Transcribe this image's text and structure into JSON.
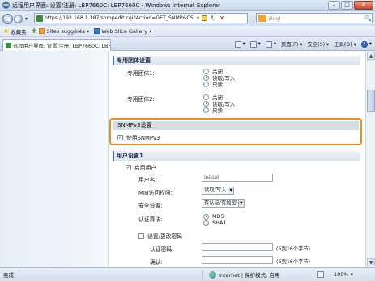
{
  "window": {
    "title": "远程用户界面: 设置/注册: LBP7660C: LBP7660C - Windows Internet Explorer",
    "minimize": "–",
    "maximize": "□",
    "close": "✕"
  },
  "browser": {
    "back": "◀",
    "forward": "▶",
    "nav_dropdown": "▾",
    "url": "https://192.168.1.187/snmpedit.cgi?Action=GET_SNMP&CSUT=-1(",
    "url_dropdown": "▾",
    "refresh": "↻",
    "stop": "✕",
    "search_placeholder": "Bing",
    "search_go": "🔍"
  },
  "favorites_bar": {
    "favorites_label": "收藏夹",
    "items": [
      "Sites suggérés ▾",
      "Web Slice Gallery ▾"
    ]
  },
  "tab": {
    "title": "远程用户界面: 设置/注册: LBP7660C: LBP7660C"
  },
  "command_bar": {
    "items": [
      "▾",
      "▾",
      "▾",
      "页面(P) ▾",
      "安全(S) ▾",
      "工具(O) ▾",
      "▾"
    ]
  },
  "content": {
    "community_section": {
      "header": "专用团体设置",
      "community1_label": "专用团体1:",
      "community2_label": "专用团体2:",
      "options": [
        "关闭",
        "读取/写入",
        "只读"
      ],
      "community1_selected": "读取/写入",
      "community2_selected": "读取/写入"
    },
    "snmpv3_section": {
      "header": "SNMPv3设置",
      "use_snmpv3_label": "使用SNMPv3",
      "use_snmpv3_checked": true
    },
    "user_section": {
      "header": "用户设置1",
      "enable_user_label": "启用用户",
      "enable_user_checked": true,
      "username_label": "用户名:",
      "username_value": "initial",
      "mib_access_label": "MIB访问权限:",
      "mib_access_value": "读取/写入",
      "security_label": "安全设置:",
      "security_value": "有认证/有加密",
      "auth_algorithm_label": "认证算法:",
      "auth_options": [
        "MD5",
        "SHA1"
      ],
      "auth_selected": "MD5",
      "set_change_password_label": "设置/更改密码",
      "set_change_password_checked": false,
      "auth_password_label": "认证密码:",
      "auth_password_hint": "(6到16个字节)",
      "confirm_label": "确认:",
      "confirm_hint": "(6到16个字节)"
    }
  },
  "status_bar": {
    "status": "完成",
    "zone": "Internet | 保护模式: 启用",
    "zoom": "100% ▾"
  },
  "colors": {
    "highlight_border": "#f08c1a",
    "section_accent": "#4e6f9b"
  }
}
